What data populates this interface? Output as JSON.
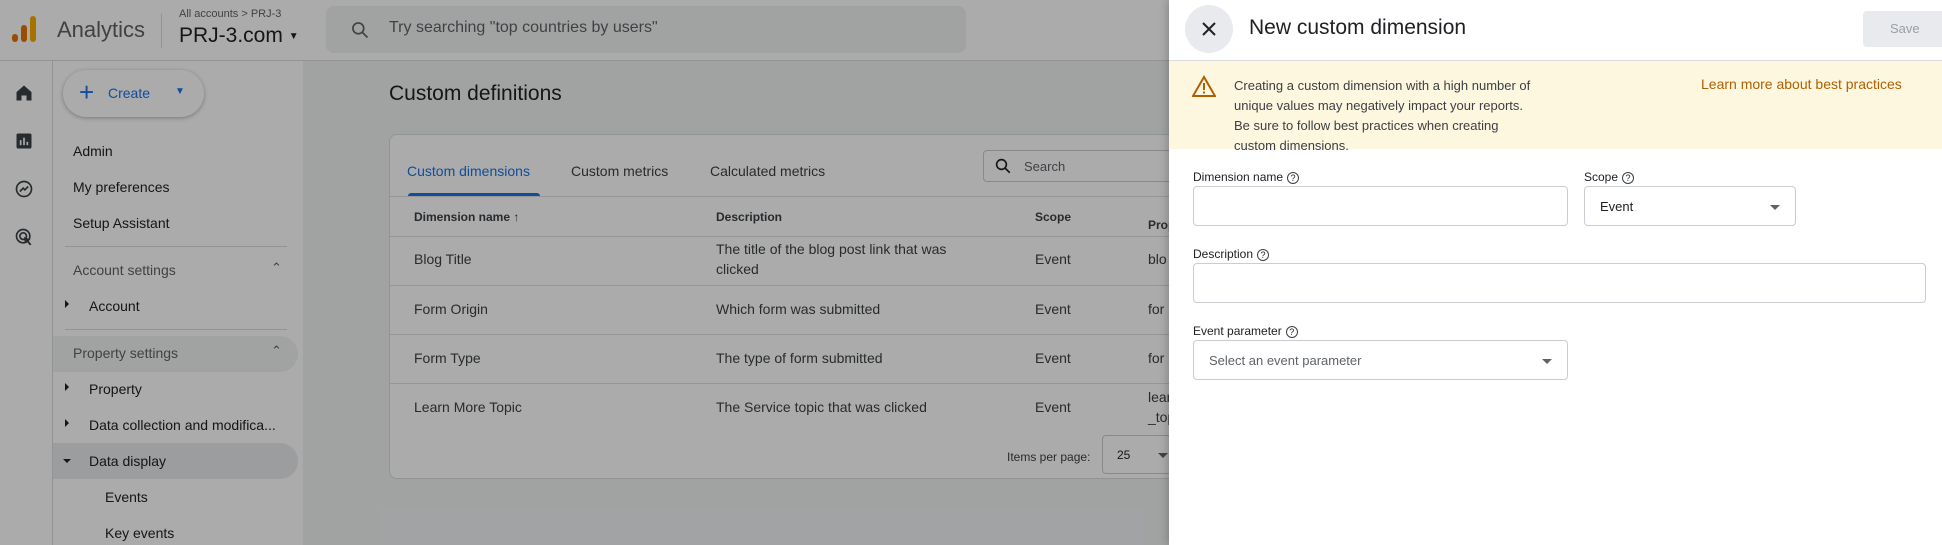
{
  "topbar": {
    "app_name": "Analytics",
    "breadcrumb": "All accounts > PRJ-3",
    "property": "PRJ-3.com",
    "search_placeholder": "Try searching \"top countries by users\""
  },
  "sidebar": {
    "create_label": "Create",
    "items": [
      {
        "label": "Admin"
      },
      {
        "label": "My preferences"
      },
      {
        "label": "Setup Assistant"
      },
      {
        "label": "Account settings"
      },
      {
        "label": "Account"
      },
      {
        "label": "Property settings"
      },
      {
        "label": "Property"
      },
      {
        "label": "Data collection and modifica..."
      },
      {
        "label": "Data display"
      },
      {
        "label": "Events"
      },
      {
        "label": "Key events"
      }
    ]
  },
  "main": {
    "title": "Custom definitions",
    "tabs": [
      {
        "label": "Custom dimensions",
        "active": true
      },
      {
        "label": "Custom metrics"
      },
      {
        "label": "Calculated metrics"
      }
    ],
    "search_placeholder": "Search",
    "columns": [
      "Dimension name",
      "Description",
      "Scope",
      "Prop"
    ],
    "rows": [
      {
        "name": "Blog Title",
        "description": "The title of the blog post link that was clicked",
        "scope": "Event",
        "param": "blo"
      },
      {
        "name": "Form Origin",
        "description": "Which form was submitted",
        "scope": "Event",
        "param": "for"
      },
      {
        "name": "Form Type",
        "description": "The type of form submitted",
        "scope": "Event",
        "param": "for"
      },
      {
        "name": "Learn More Topic",
        "description": "The Service topic that was clicked",
        "scope": "Event",
        "param": "lear _top"
      }
    ],
    "items_per_page_label": "Items per page:",
    "items_per_page": "25"
  },
  "panel": {
    "title": "New custom dimension",
    "save_label": "Save",
    "warning": "Creating a custom dimension with a high number of unique values may negatively impact your reports. Be sure to follow best practices when creating custom dimensions.",
    "learn_more": "Learn more about best practices",
    "dimension_name_label": "Dimension name",
    "dimension_name_value": "",
    "scope_label": "Scope",
    "scope_value": "Event",
    "description_label": "Description",
    "description_value": "",
    "event_param_label": "Event parameter",
    "event_param_placeholder": "Select an event parameter"
  },
  "colors": {
    "accent": "#1a73e8",
    "warning_bg": "#fef7e0",
    "warning_link": "#b06000",
    "logo_orange": "#f9ab00",
    "logo_dark": "#e37400"
  }
}
